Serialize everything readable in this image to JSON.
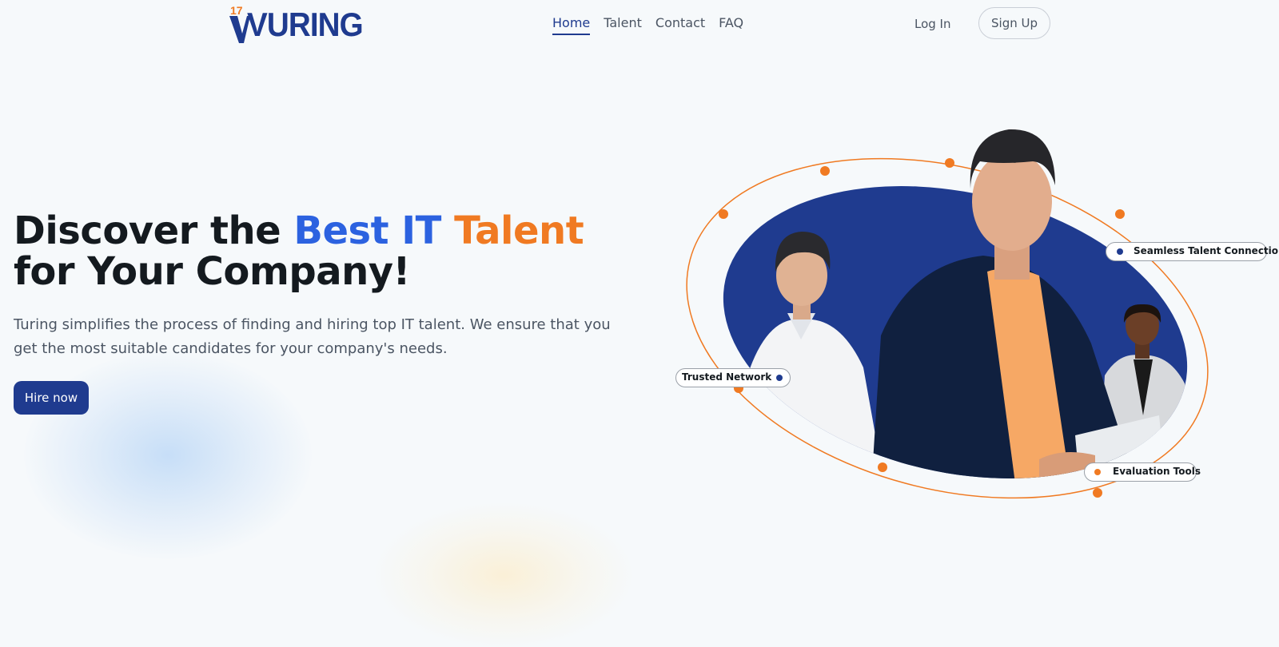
{
  "brand": {
    "logo_number": "17",
    "logo_word": "VURING"
  },
  "nav": {
    "items": [
      {
        "label": "Home",
        "active": true
      },
      {
        "label": "Talent"
      },
      {
        "label": "Contact"
      },
      {
        "label": "FAQ"
      }
    ],
    "login_label": "Log In",
    "signup_label": "Sign Up"
  },
  "hero": {
    "title_part1": "Discover the ",
    "title_highlight_blue": "Best IT",
    "title_highlight_orange": "Talent",
    "title_part2": " for Your Company!",
    "subtitle": "Turing simplifies the process of finding and hiring top IT talent. We ensure that you get the most suitable candidates for your company's needs.",
    "cta_label": "Hire now"
  },
  "illustration": {
    "tags": {
      "trusted": "Trusted Network",
      "seamless": "Seamless Talent Connection",
      "evaluation": "Evaluation Tools"
    }
  },
  "colors": {
    "brand_navy": "#1f3b8f",
    "accent_blue": "#2c62e0",
    "accent_orange": "#f07a22",
    "background": "#f6f9fb"
  }
}
